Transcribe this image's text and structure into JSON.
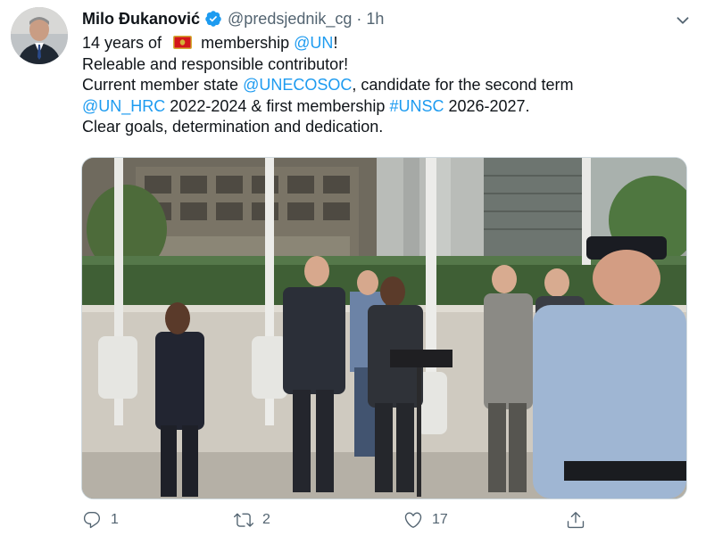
{
  "author": {
    "name": "Milo Đukanović",
    "handle": "@predsjednik_cg",
    "separator": "·",
    "time": "1h"
  },
  "tweet": {
    "line1": {
      "pre": "14 years of",
      "flag": "montenegro-flag-emoji",
      "mid": "membership",
      "mention": "@UN",
      "post": "!"
    },
    "line2": "Releable and responsible contributor!",
    "line3": {
      "pre": "Current member state",
      "mention": "@UNECOSOC",
      "post": ", candidate for the second term"
    },
    "line4": {
      "mention": "@UN_HRC",
      "mid": "2022-2024 & first membership",
      "hashtag": "#UNSC",
      "post": "2026-2027."
    },
    "line5": "Clear goals, determination and dedication."
  },
  "actions": {
    "reply_count": "1",
    "retweet_count": "2",
    "like_count": "17"
  },
  "icons": {
    "verified": "verified-badge-icon",
    "more": "chevron-down-icon",
    "reply": "reply-icon",
    "retweet": "retweet-icon",
    "like": "heart-icon",
    "share": "share-icon"
  },
  "colors": {
    "link": "#1d9bf0",
    "muted": "#536471",
    "verified": "#1d9bf0"
  }
}
